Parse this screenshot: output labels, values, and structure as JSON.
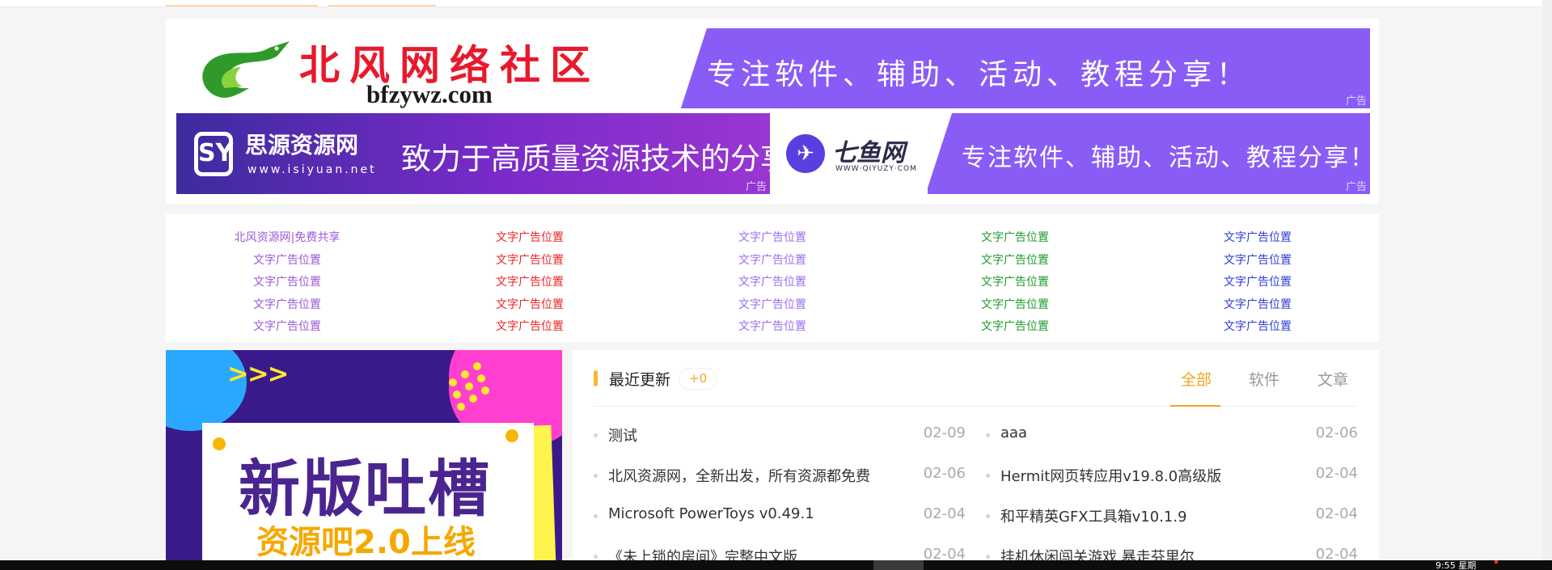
{
  "banners": {
    "top": {
      "brand": "北风网络社区",
      "domain": "bfzywz.com",
      "slogan": "专注软件、辅助、活动、教程分享！",
      "tag": "广告"
    },
    "left": {
      "mark": "SY",
      "name": "思源资源网",
      "url": "www.isiyuan.net",
      "slogan": "致力于高质量资源技术的分享",
      "tag": "广告"
    },
    "right": {
      "name": "七鱼网",
      "url": "WWW·QIYUZY·COM",
      "slogan": "专注软件、辅助、活动、教程分享！",
      "tag": "广告"
    }
  },
  "text_ads": {
    "columns": [
      {
        "color": "#9b59d8",
        "items": [
          "北风资源网|免费共享",
          "文字广告位置",
          "文字广告位置",
          "文字广告位置",
          "文字广告位置"
        ]
      },
      {
        "color": "#ee2323",
        "items": [
          "文字广告位置",
          "文字广告位置",
          "文字广告位置",
          "文字广告位置",
          "文字广告位置"
        ]
      },
      {
        "color": "#9b6ef0",
        "items": [
          "文字广告位置",
          "文字广告位置",
          "文字广告位置",
          "文字广告位置",
          "文字广告位置"
        ]
      },
      {
        "color": "#1e9b2b",
        "items": [
          "文字广告位置",
          "文字广告位置",
          "文字广告位置",
          "文字广告位置",
          "文字广告位置"
        ]
      },
      {
        "color": "#2e3cd6",
        "items": [
          "文字广告位置",
          "文字广告位置",
          "文字广告位置",
          "文字广告位置",
          "文字广告位置"
        ]
      }
    ]
  },
  "promo": {
    "arrows": ">>>",
    "headline": "新版吐槽",
    "subline": "资源吧2.0上线"
  },
  "recent": {
    "title": "最近更新",
    "count": "+0",
    "tabs": [
      "全部",
      "软件",
      "文章"
    ],
    "active_tab": "全部",
    "items": [
      {
        "title": "测试",
        "date": "02-09"
      },
      {
        "title": "aaa",
        "date": "02-06"
      },
      {
        "title": "北风资源网，全新出发，所有资源都免费",
        "date": "02-06"
      },
      {
        "title": "Hermit网页转应用v19.8.0高级版",
        "date": "02-04"
      },
      {
        "title": "Microsoft PowerToys v0.49.1",
        "date": "02-04"
      },
      {
        "title": "和平精英GFX工具箱v10.1.9",
        "date": "02-04"
      },
      {
        "title": "《未上锁的房间》完整中文版",
        "date": "02-04"
      },
      {
        "title": "挂机休闲闯关游戏 暴走芬里尔",
        "date": "02-04"
      }
    ]
  },
  "taskbar": {
    "clock": "9:55 星期"
  },
  "colors": {
    "accent": "#f7a41b",
    "banner_purple": "#8a5cf6",
    "brand_red": "#e8192c"
  }
}
